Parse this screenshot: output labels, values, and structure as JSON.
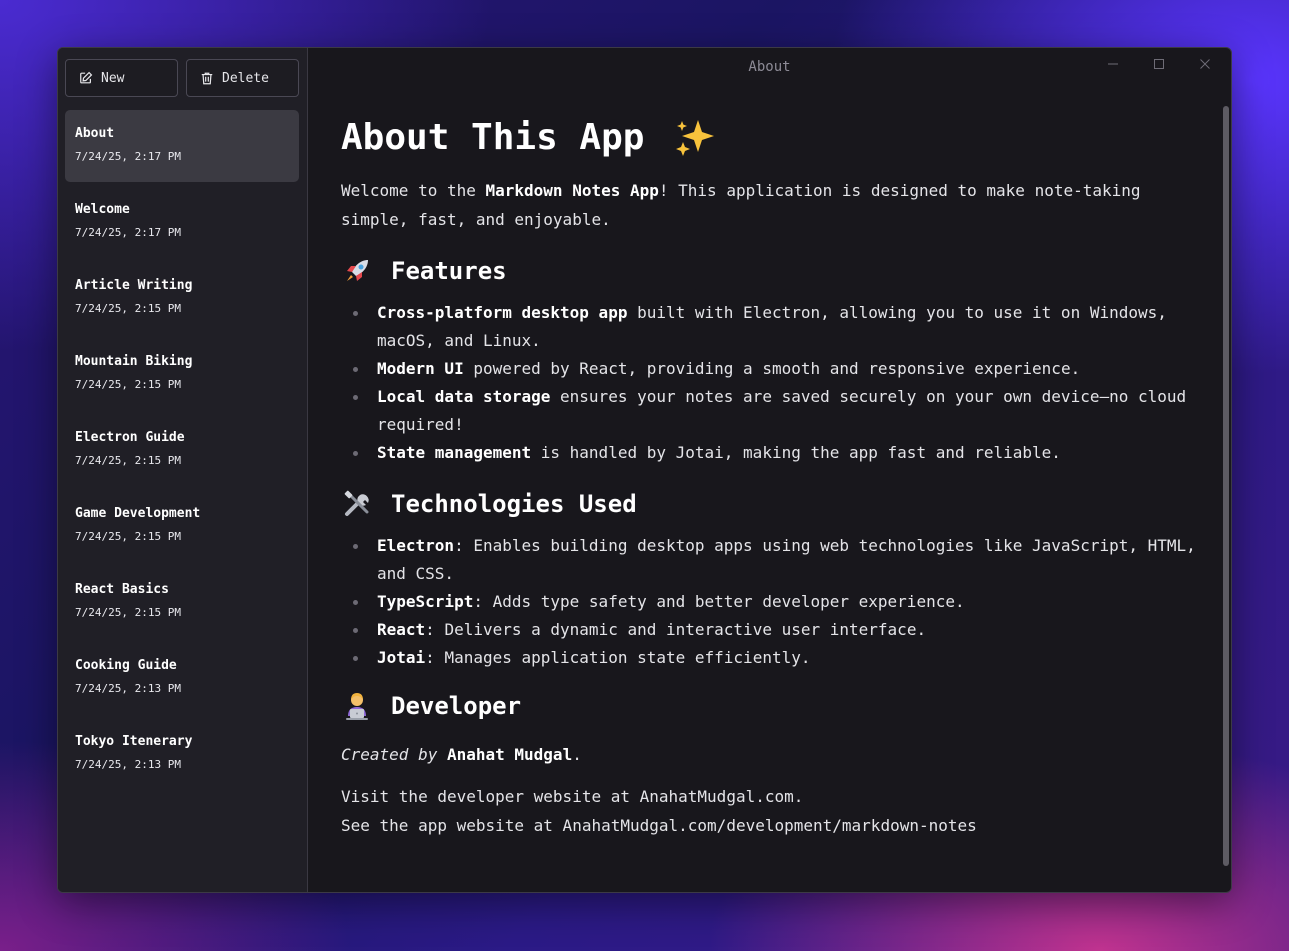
{
  "window": {
    "title": "About",
    "controls": {
      "minimize_icon": "minimize-icon",
      "maximize_icon": "maximize-icon",
      "close_icon": "close-icon"
    }
  },
  "toolbar": {
    "new_label": "New",
    "delete_label": "Delete"
  },
  "notes": [
    {
      "title": "About",
      "date": "7/24/25, 2:17 PM",
      "selected": true
    },
    {
      "title": "Welcome",
      "date": "7/24/25, 2:17 PM"
    },
    {
      "title": "Article Writing",
      "date": "7/24/25, 2:15 PM"
    },
    {
      "title": "Mountain Biking",
      "date": "7/24/25, 2:15 PM"
    },
    {
      "title": "Electron Guide",
      "date": "7/24/25, 2:15 PM"
    },
    {
      "title": "Game Development",
      "date": "7/24/25, 2:15 PM"
    },
    {
      "title": "React Basics",
      "date": "7/24/25, 2:15 PM"
    },
    {
      "title": "Cooking Guide",
      "date": "7/24/25, 2:13 PM"
    },
    {
      "title": "Tokyo Itenerary",
      "date": "7/24/25, 2:13 PM"
    }
  ],
  "doc": {
    "h1": "About This App",
    "intro": {
      "t1": "Welcome to the ",
      "b1": "Markdown Notes App",
      "t2": "! This application is designed to make note-taking simple, fast, and enjoyable."
    },
    "features": {
      "heading": "Features",
      "items": [
        {
          "bold": "Cross-platform desktop app",
          "text": " built with Electron, allowing you to use it on Windows, macOS, and Linux."
        },
        {
          "bold": "Modern UI",
          "text": " powered by React, providing a smooth and responsive experience."
        },
        {
          "bold": "Local data storage",
          "text": " ensures your notes are saved securely on your own device—no cloud required!"
        },
        {
          "bold": "State management",
          "text": " is handled by Jotai, making the app fast and reliable."
        }
      ]
    },
    "tech": {
      "heading": "Technologies Used",
      "items": [
        {
          "bold": "Electron",
          "text": ": Enables building desktop apps using web technologies like JavaScript, HTML, and CSS."
        },
        {
          "bold": "TypeScript",
          "text": ": Adds type safety and better developer experience."
        },
        {
          "bold": "React",
          "text": ": Delivers a dynamic and interactive user interface."
        },
        {
          "bold": "Jotai",
          "text": ": Manages application state efficiently."
        }
      ]
    },
    "developer": {
      "heading": "Developer",
      "created_prefix": "Created by",
      "name": "Anahat Mudgal",
      "suffix": ".",
      "visit_line": "Visit the developer website at AnahatMudgal.com.",
      "app_line": "See the app website at AnahatMudgal.com/development/markdown-notes"
    }
  },
  "colors": {
    "window_bg": "#18171c",
    "sidebar_bg": "#201f26",
    "selected_bg": "#3b3a42",
    "text": "#e4e4e8"
  }
}
